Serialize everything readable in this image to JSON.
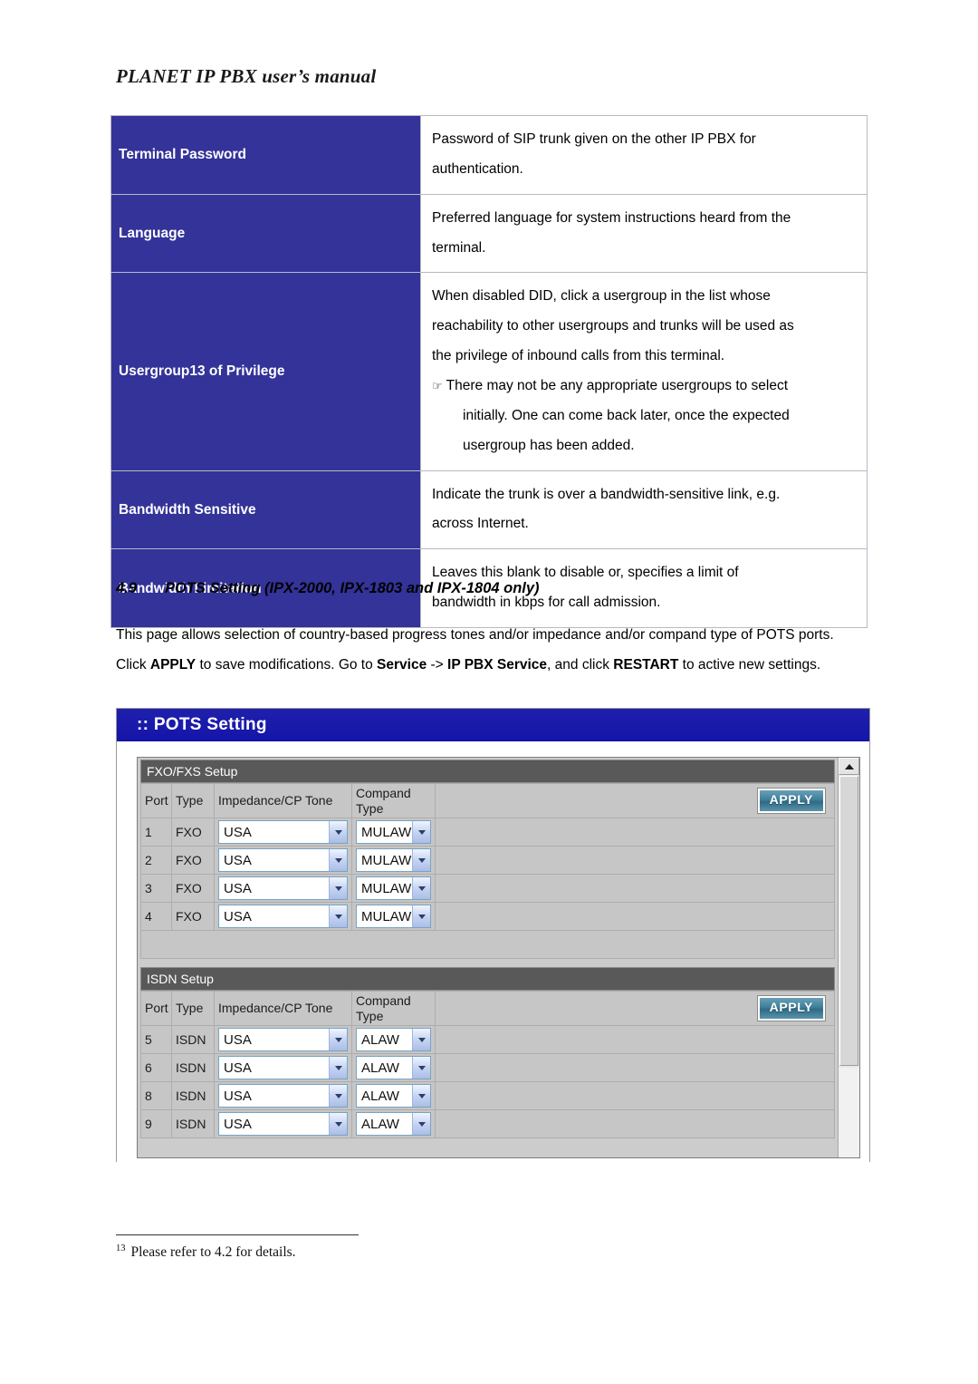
{
  "document": {
    "running_head": "PLANET IP PBX user’s manual",
    "footnote_marker": "13",
    "footnote_text": "Please refer to 4.2 for details."
  },
  "parameter_table": {
    "rows": [
      {
        "label": "Terminal Password",
        "lines": [
          "Password of SIP trunk given on the other IP PBX for",
          "authentication."
        ]
      },
      {
        "label": "Language",
        "lines": [
          "Preferred language for system instructions heard from the",
          "terminal."
        ]
      },
      {
        "label": "Usergroup13 of Privilege",
        "lines": [
          "When disabled DID, click a usergroup in the list whose",
          "reachability to other usergroups and trunks will be used as",
          "the privilege of inbound calls from this terminal."
        ],
        "note_lines": [
          "There may not be any appropriate usergroups to select",
          "initially. One can come back later, once the expected",
          "usergroup has been added."
        ],
        "note_glyph": "☞"
      },
      {
        "label": "Bandwidth Sensitive",
        "lines": [
          "Indicate the trunk is over a bandwidth-sensitive link, e.g.",
          "across Internet."
        ]
      },
      {
        "label": "Bandwidth Limitation",
        "lines": [
          "Leaves this blank to disable or, specifies a limit of",
          "bandwidth in kbps for call admission."
        ]
      }
    ]
  },
  "section": {
    "number": "4.9",
    "title": "POTS Setting (IPX-2000, IPX-1803 and IPX-1804 only)",
    "paragraph_html": "This page allows selection of country-based progress tones and/or impedance and/or compand type of POTS ports. Click <b>APPLY</b> to save modifications. Go to <b>Service</b> -&gt; <b>IP PBX Service</b>, and click <b>RESTART</b> to active new settings."
  },
  "screenshot": {
    "window_title": ":: POTS Setting",
    "columns": [
      "Port",
      "Type",
      "Impedance/CP Tone",
      "Compand Type"
    ],
    "apply_label": "APPLY",
    "sections": [
      {
        "heading": "FXO/FXS Setup",
        "rows": [
          {
            "port": "1",
            "type": "FXO",
            "impedance": "USA",
            "compand": "MULAW"
          },
          {
            "port": "2",
            "type": "FXO",
            "impedance": "USA",
            "compand": "MULAW"
          },
          {
            "port": "3",
            "type": "FXO",
            "impedance": "USA",
            "compand": "MULAW"
          },
          {
            "port": "4",
            "type": "FXO",
            "impedance": "USA",
            "compand": "MULAW"
          }
        ]
      },
      {
        "heading": "ISDN Setup",
        "rows": [
          {
            "port": "5",
            "type": "ISDN",
            "impedance": "USA",
            "compand": "ALAW"
          },
          {
            "port": "6",
            "type": "ISDN",
            "impedance": "USA",
            "compand": "ALAW"
          },
          {
            "port": "8",
            "type": "ISDN",
            "impedance": "USA",
            "compand": "ALAW"
          },
          {
            "port": "9",
            "type": "ISDN",
            "impedance": "USA",
            "compand": "ALAW"
          }
        ]
      }
    ]
  },
  "colors": {
    "table_label_blue": "#333399",
    "window_title_blue": "#1b1bb0",
    "section_strip_gray": "#595959",
    "panel_gray": "#c6c6c6",
    "apply_teal": "#3d7f9b"
  }
}
